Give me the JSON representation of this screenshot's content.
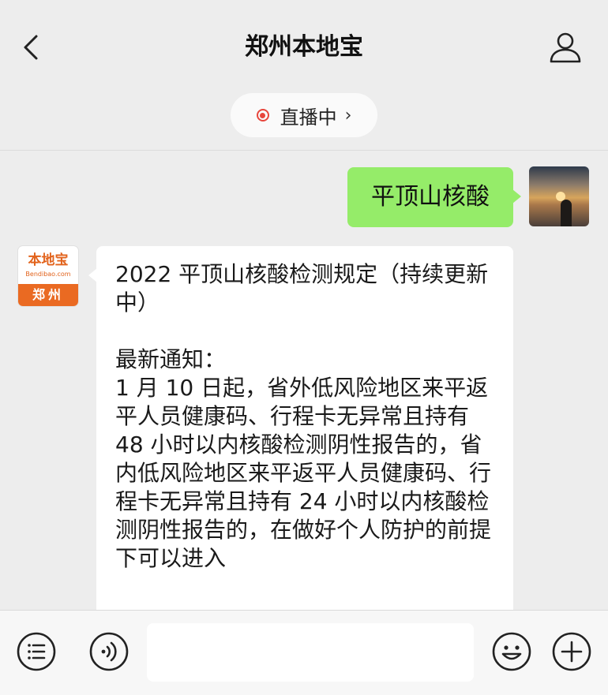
{
  "header": {
    "title": "郑州本地宝",
    "back_icon": "chevron-left-icon",
    "profile_icon": "user-icon"
  },
  "live": {
    "label": "直播中",
    "chevron": "›",
    "dot_color": "#e7463c"
  },
  "messages": {
    "user_text": "平顶山核酸",
    "bubble_color": "#95ec69",
    "bot_logo": {
      "top": "本地宝",
      "url": "Bendibao.com",
      "city": "郑州",
      "brand_color": "#ea6a22"
    },
    "bot_title": "2022 平顶山核酸检测规定（持续更新中）",
    "bot_label": "最新通知：",
    "bot_body": "1 月 10 日起，省外低风险地区来平返平人员健康码、行程卡无异常且持有 48 小时以内核酸检测阴性报告的，省内低风险地区来平返平人员健康码、行程卡无异常且持有 24 小时以内核酸检测阴性报告的，在做好个人防护的前提下可以进入"
  },
  "toolbar": {
    "menu_icon": "list-icon",
    "voice_icon": "voice-icon",
    "emoji_icon": "emoji-icon",
    "plus_icon": "plus-icon",
    "input_value": ""
  }
}
